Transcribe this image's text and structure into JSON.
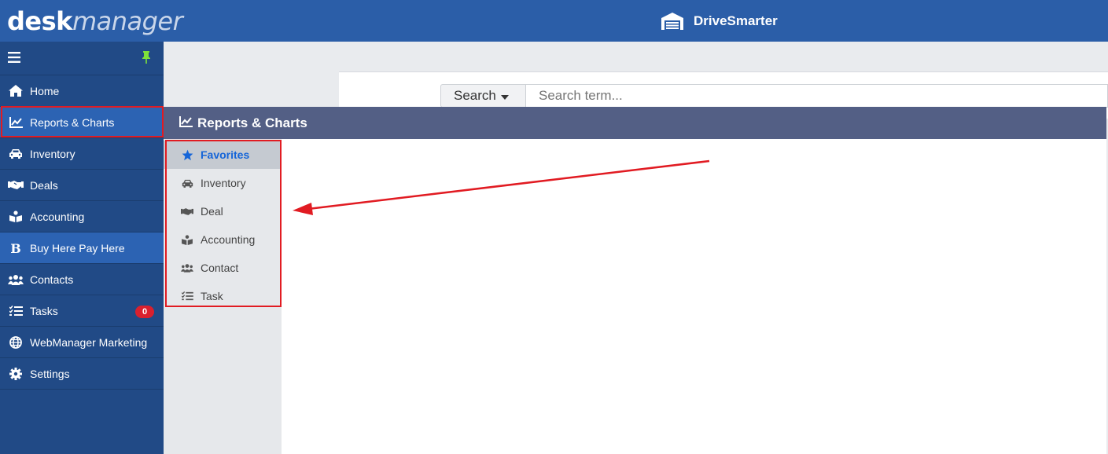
{
  "logo": {
    "part1": "desk",
    "part2": "manager"
  },
  "header": {
    "brand": "DriveSmarter"
  },
  "sidebar": {
    "items": [
      {
        "label": "Home",
        "icon": "home-icon"
      },
      {
        "label": "Reports & Charts",
        "icon": "chart-line-icon"
      },
      {
        "label": "Inventory",
        "icon": "car-icon"
      },
      {
        "label": "Deals",
        "icon": "handshake-icon"
      },
      {
        "label": "Accounting",
        "icon": "book-icon"
      },
      {
        "label": "Buy Here Pay Here",
        "icon": "bhph-b-icon"
      },
      {
        "label": "Contacts",
        "icon": "users-icon"
      },
      {
        "label": "Tasks",
        "icon": "tasks-icon",
        "badge": "0"
      },
      {
        "label": "WebManager Marketing",
        "icon": "globe-icon"
      },
      {
        "label": "Settings",
        "icon": "gear-icon"
      }
    ]
  },
  "search": {
    "button_label": "Search",
    "placeholder": "Search term..."
  },
  "flyout": {
    "title": "Reports & Charts",
    "items": [
      {
        "label": "Favorites",
        "icon": "star-icon"
      },
      {
        "label": "Inventory",
        "icon": "car-icon"
      },
      {
        "label": "Deal",
        "icon": "handshake-icon"
      },
      {
        "label": "Accounting",
        "icon": "book-icon"
      },
      {
        "label": "Contact",
        "icon": "users-icon"
      },
      {
        "label": "Task",
        "icon": "tasks-icon"
      }
    ]
  },
  "colors": {
    "topbar": "#2b5ea8",
    "sidebar": "#214a86",
    "sidebar_active": "#2c63b3",
    "flyout_header": "#535f85",
    "selected_text": "#1565d8",
    "annotation_red": "#e11b22",
    "pin": "#7ee23a",
    "badge": "#d9202e"
  }
}
